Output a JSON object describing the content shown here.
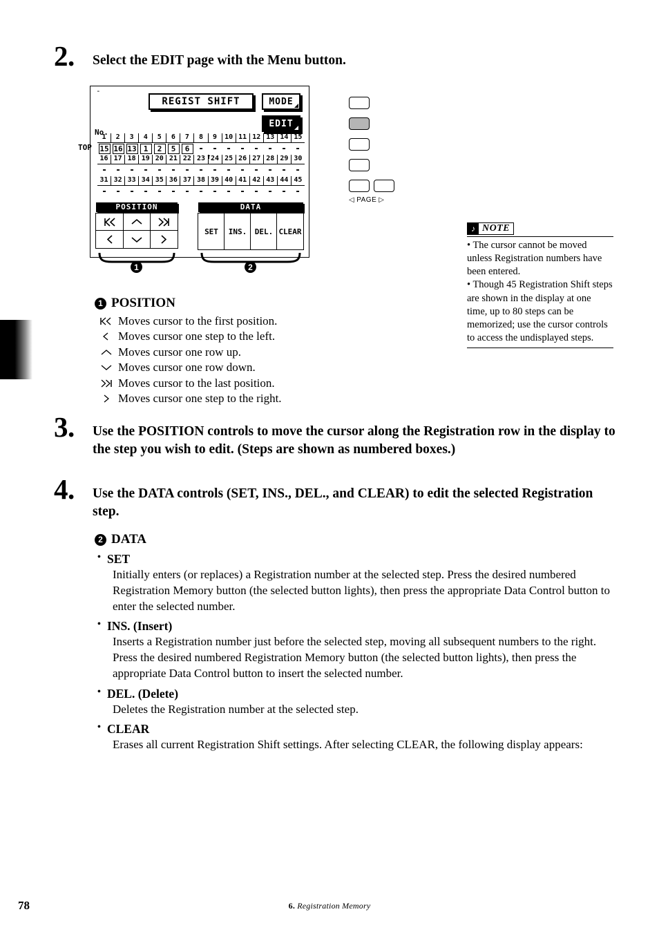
{
  "steps": {
    "step2": {
      "number": "2.",
      "text": "Select the EDIT page with the Menu button."
    },
    "step3": {
      "number": "3.",
      "text": "Use the POSITION controls to move the cursor along the Registration row in the display to the step you wish to edit.  (Steps are shown as numbered boxes.)"
    },
    "step4": {
      "number": "4.",
      "text": "Use the DATA controls (SET, INS., DEL., and CLEAR) to edit the selected Registration step."
    }
  },
  "lcd": {
    "corner_mark": "-",
    "title_button": "REGIST SHIFT",
    "mode_button": "MODE",
    "edit_button": "EDIT",
    "no_label": "No.",
    "top_label": "TOP",
    "rows": [
      {
        "numbers": [
          "1",
          "2",
          "3",
          "4",
          "5",
          "6",
          "7",
          "8",
          "9",
          "10",
          "11",
          "12",
          "13",
          "14",
          "15"
        ],
        "values": [
          "15",
          "16",
          "13",
          "1",
          "2",
          "5",
          "6",
          "-",
          "-",
          "-",
          "-",
          "-",
          "-",
          "-",
          "-"
        ]
      },
      {
        "numbers": [
          "16",
          "17",
          "18",
          "19",
          "20",
          "21",
          "22",
          "23",
          "24",
          "25",
          "26",
          "27",
          "28",
          "29",
          "30"
        ],
        "values": [
          "-",
          "-",
          "-",
          "-",
          "-",
          "-",
          "-",
          "-",
          "-",
          "-",
          "-",
          "-",
          "-",
          "-",
          "-"
        ]
      },
      {
        "numbers": [
          "31",
          "32",
          "33",
          "34",
          "35",
          "36",
          "37",
          "38",
          "39",
          "40",
          "41",
          "42",
          "43",
          "44",
          "45"
        ],
        "values": [
          "-",
          "-",
          "-",
          "-",
          "-",
          "-",
          "-",
          "-",
          "-",
          "-",
          "-",
          "-",
          "-",
          "-",
          "-"
        ]
      }
    ],
    "cursor_marker": "↑",
    "cursor_at_step": "23",
    "position_group": {
      "header": "POSITION",
      "keys": [
        {
          "name": "first-position-key",
          "glyph": "first"
        },
        {
          "name": "row-up-key",
          "glyph": "up"
        },
        {
          "name": "last-position-key",
          "glyph": "last"
        },
        {
          "name": "step-left-key",
          "glyph": "left"
        },
        {
          "name": "row-down-key",
          "glyph": "down"
        },
        {
          "name": "step-right-key",
          "glyph": "right"
        }
      ]
    },
    "data_group": {
      "header": "DATA",
      "keys": [
        "SET",
        "INS.",
        "DEL.",
        "CLEAR"
      ]
    },
    "callouts": {
      "position": "1",
      "data": "2"
    }
  },
  "hardware": {
    "buttons": [
      {
        "name": "menu-button-1",
        "lit": false
      },
      {
        "name": "menu-button-2",
        "lit": true
      },
      {
        "name": "menu-button-3",
        "lit": false
      },
      {
        "name": "menu-button-4",
        "lit": false
      }
    ],
    "page_buttons": [
      {
        "name": "page-prev-button"
      },
      {
        "name": "page-next-button"
      }
    ],
    "page_label": "PAGE",
    "page_prev_glyph": "◁",
    "page_next_glyph": "▷"
  },
  "note": {
    "icon": "♪",
    "title": "NOTE",
    "items": [
      "• The cursor cannot be moved unless Registration numbers have been entered.",
      "• Though 45 Registration Shift steps are shown in the display at one time, up to 80 steps can be memorized; use the cursor controls to access the undisplayed steps."
    ]
  },
  "position_section": {
    "callout": "1",
    "title": "POSITION",
    "items": [
      {
        "glyph": "first",
        "text": "Moves cursor to the first position."
      },
      {
        "glyph": "left",
        "text": "Moves cursor one step to the left."
      },
      {
        "glyph": "up",
        "text": "Moves cursor one row up."
      },
      {
        "glyph": "down",
        "text": "Moves cursor one row down."
      },
      {
        "glyph": "last",
        "text": "Moves cursor to the last position."
      },
      {
        "glyph": "right",
        "text": "Moves cursor one step to the right."
      }
    ]
  },
  "data_section": {
    "callout": "2",
    "title": "DATA",
    "entries": [
      {
        "label": "SET",
        "description": "Initially enters (or replaces) a Registration number at the selected step.  Press the desired numbered Registration Memory button (the selected button lights), then press the appropriate Data Control button to enter the selected number."
      },
      {
        "label": "INS. (Insert)",
        "description": "Inserts a Registration number just before the selected step, moving all subsequent numbers to the right.  Press the desired numbered Registration Memory button (the selected button lights), then press the appropriate Data Control button to insert the selected number."
      },
      {
        "label": "DEL. (Delete)",
        "description": "Deletes the Registration number at the selected step."
      },
      {
        "label": "CLEAR",
        "description": "Erases all current Registration Shift settings.  After selecting CLEAR, the following display appears:"
      }
    ]
  },
  "footer": {
    "page_number": "78",
    "chapter_number": "6.",
    "chapter_title": "Registration Memory"
  },
  "colors": {
    "ink": "#000000",
    "paper": "#ffffff",
    "lit_button": "#b5b5b5"
  }
}
